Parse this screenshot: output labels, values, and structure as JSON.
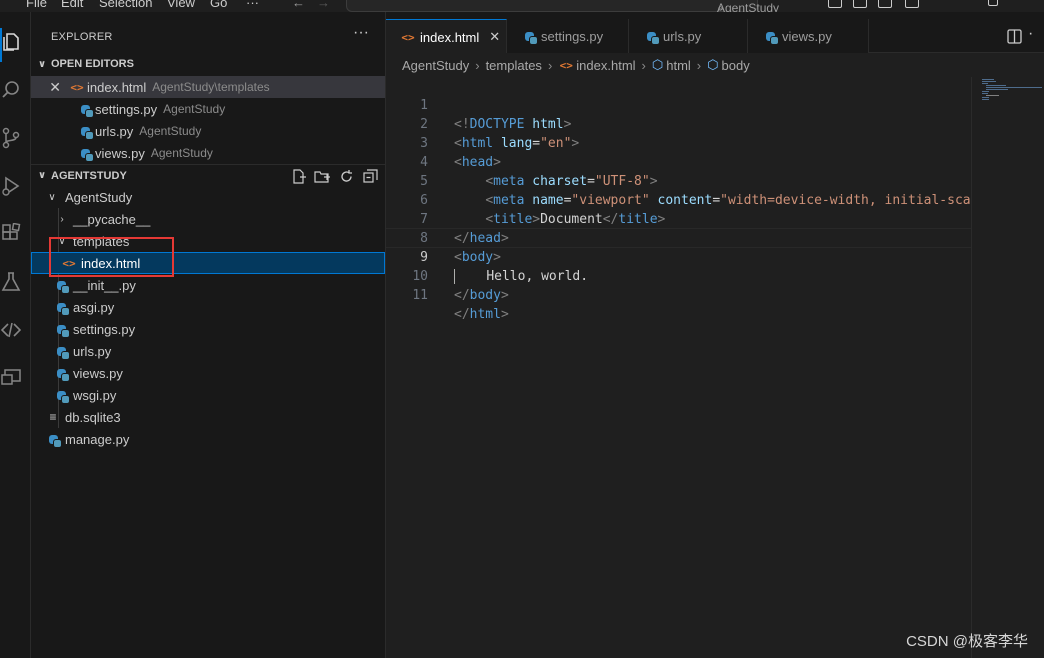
{
  "menu": [
    "File",
    "Edit",
    "Selection",
    "View",
    "Go"
  ],
  "menu_more": "···",
  "search_label": "AgentStudy",
  "explorer": {
    "title": "EXPLORER",
    "more": "···",
    "open_editors_title": "OPEN EDITORS",
    "open_editors": [
      {
        "name": "index.html",
        "desc": "AgentStudy\\templates",
        "type": "html"
      },
      {
        "name": "settings.py",
        "desc": "AgentStudy",
        "type": "py"
      },
      {
        "name": "urls.py",
        "desc": "AgentStudy",
        "type": "py"
      },
      {
        "name": "views.py",
        "desc": "AgentStudy",
        "type": "py"
      }
    ],
    "project_title": "AGENTSTUDY",
    "tree": {
      "folder": "AgentStudy",
      "pycache": "__pycache__",
      "templates": "templates",
      "index": "index.html",
      "init": "__init__.py",
      "asgi": "asgi.py",
      "settings": "settings.py",
      "urls": "urls.py",
      "views": "views.py",
      "wsgi": "wsgi.py",
      "db": "db.sqlite3",
      "manage": "manage.py"
    }
  },
  "tabs": [
    {
      "label": "index.html",
      "type": "html",
      "active": true
    },
    {
      "label": "settings.py",
      "type": "py"
    },
    {
      "label": "urls.py",
      "type": "py"
    },
    {
      "label": "views.py",
      "type": "py"
    }
  ],
  "breadcrumb": [
    "AgentStudy",
    "templates",
    "index.html",
    "html",
    "body"
  ],
  "code_lines": [
    "<!DOCTYPE html>",
    "<html lang=\"en\">",
    "<head>",
    "    <meta charset=\"UTF-8\">",
    "    <meta name=\"viewport\" content=\"width=device-width, initial-scale",
    "    <title>Document</title>",
    "</head>",
    "<body>",
    "    Hello, world.",
    "</body>",
    "</html>"
  ],
  "line_numbers": [
    "1",
    "2",
    "3",
    "4",
    "5",
    "6",
    "7",
    "8",
    "9",
    "10",
    "11"
  ],
  "current_line": 9,
  "watermark": "CSDN @极客李华",
  "colors": {
    "accent": "#0078d4",
    "highlight_box": "#e53935",
    "html_icon": "#e37933",
    "py_icon": "#519aba"
  }
}
